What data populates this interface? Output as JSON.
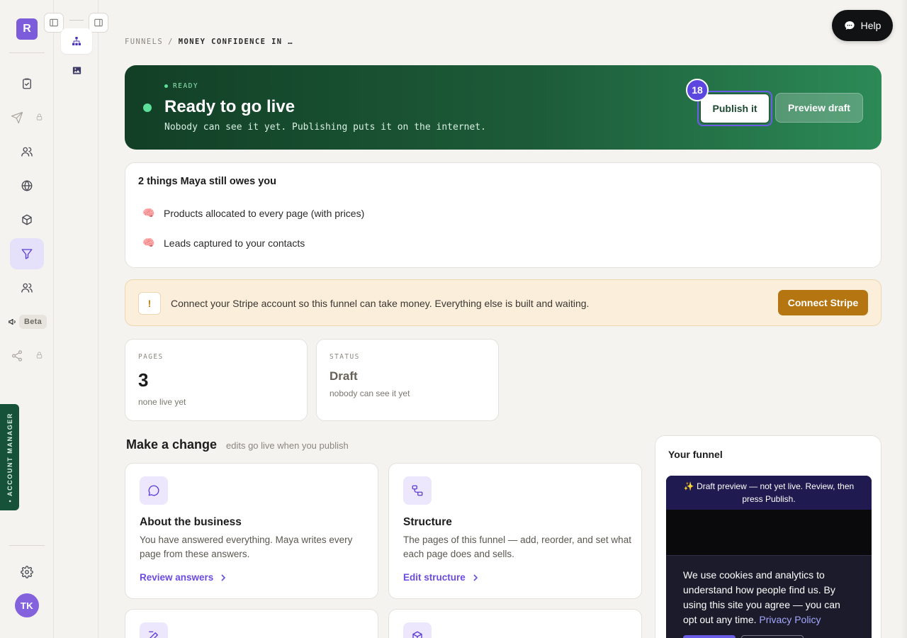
{
  "brand": {
    "letter": "R",
    "color": "#7c5cdb"
  },
  "rail": {
    "items": [
      {
        "name": "checklist",
        "icon": "clipboard-check-icon"
      },
      {
        "name": "send",
        "icon": "send-icon",
        "locked": true
      },
      {
        "name": "audience",
        "icon": "users-icon"
      },
      {
        "name": "website",
        "icon": "globe-icon"
      },
      {
        "name": "products",
        "icon": "box-icon"
      },
      {
        "name": "funnels",
        "icon": "funnel-icon",
        "active": true
      },
      {
        "name": "contacts",
        "icon": "team-icon"
      },
      {
        "name": "campaigns",
        "icon": "megaphone-icon",
        "badge": "Beta"
      },
      {
        "name": "share",
        "icon": "share-icon",
        "locked": true
      }
    ],
    "beta_label": "Beta",
    "account_manager_label": "• ACCOUNT MANAGER",
    "avatar_initials": "TK"
  },
  "breadcrumb": {
    "parent": "FUNNELS",
    "separator": "/",
    "current": "MONEY CONFIDENCE IN …"
  },
  "hero": {
    "tag": "READY",
    "title": "Ready to go live",
    "subtitle": "Nobody can see it yet. Publishing puts it on the internet.",
    "badge": "18",
    "publish_label": "Publish it",
    "preview_label": "Preview draft"
  },
  "owes": {
    "title": "2 things Maya still owes you",
    "items": [
      {
        "icon": "🧠",
        "text": "Products allocated to every page (with prices)"
      },
      {
        "icon": "🧠",
        "text": "Leads captured to your contacts"
      }
    ]
  },
  "stripe": {
    "icon": "!",
    "message": "Connect your Stripe account so this funnel can take money. Everything else is built and waiting.",
    "button": "Connect Stripe"
  },
  "stats": [
    {
      "label": "PAGES",
      "value": "3",
      "note": "none live yet"
    },
    {
      "label": "STATUS",
      "value": "Draft",
      "note": "nobody can see it yet"
    }
  ],
  "make_change": {
    "title": "Make a change",
    "subtitle": "edits go live when you publish"
  },
  "cards": [
    {
      "icon": "chat-bubble-icon",
      "title": "About the business",
      "desc": "You have answered everything. Maya writes every page from these answers.",
      "link": "Review answers"
    },
    {
      "icon": "structure-icon",
      "title": "Structure",
      "desc": "The pages of this funnel — add, reorder, and set what each page does and sells.",
      "link": "Edit structure"
    },
    {
      "icon": "edit-icon"
    },
    {
      "icon": "box-icon"
    }
  ],
  "funnel_panel": {
    "title": "Your funnel",
    "banner": "✨ Draft preview — not yet live. Review, then press Publish.",
    "cookie_text": "We use cookies and analytics to understand how people find us. By using this site you agree — you can opt out any time.",
    "cookie_link": "Privacy Policy"
  },
  "help_label": "Help"
}
